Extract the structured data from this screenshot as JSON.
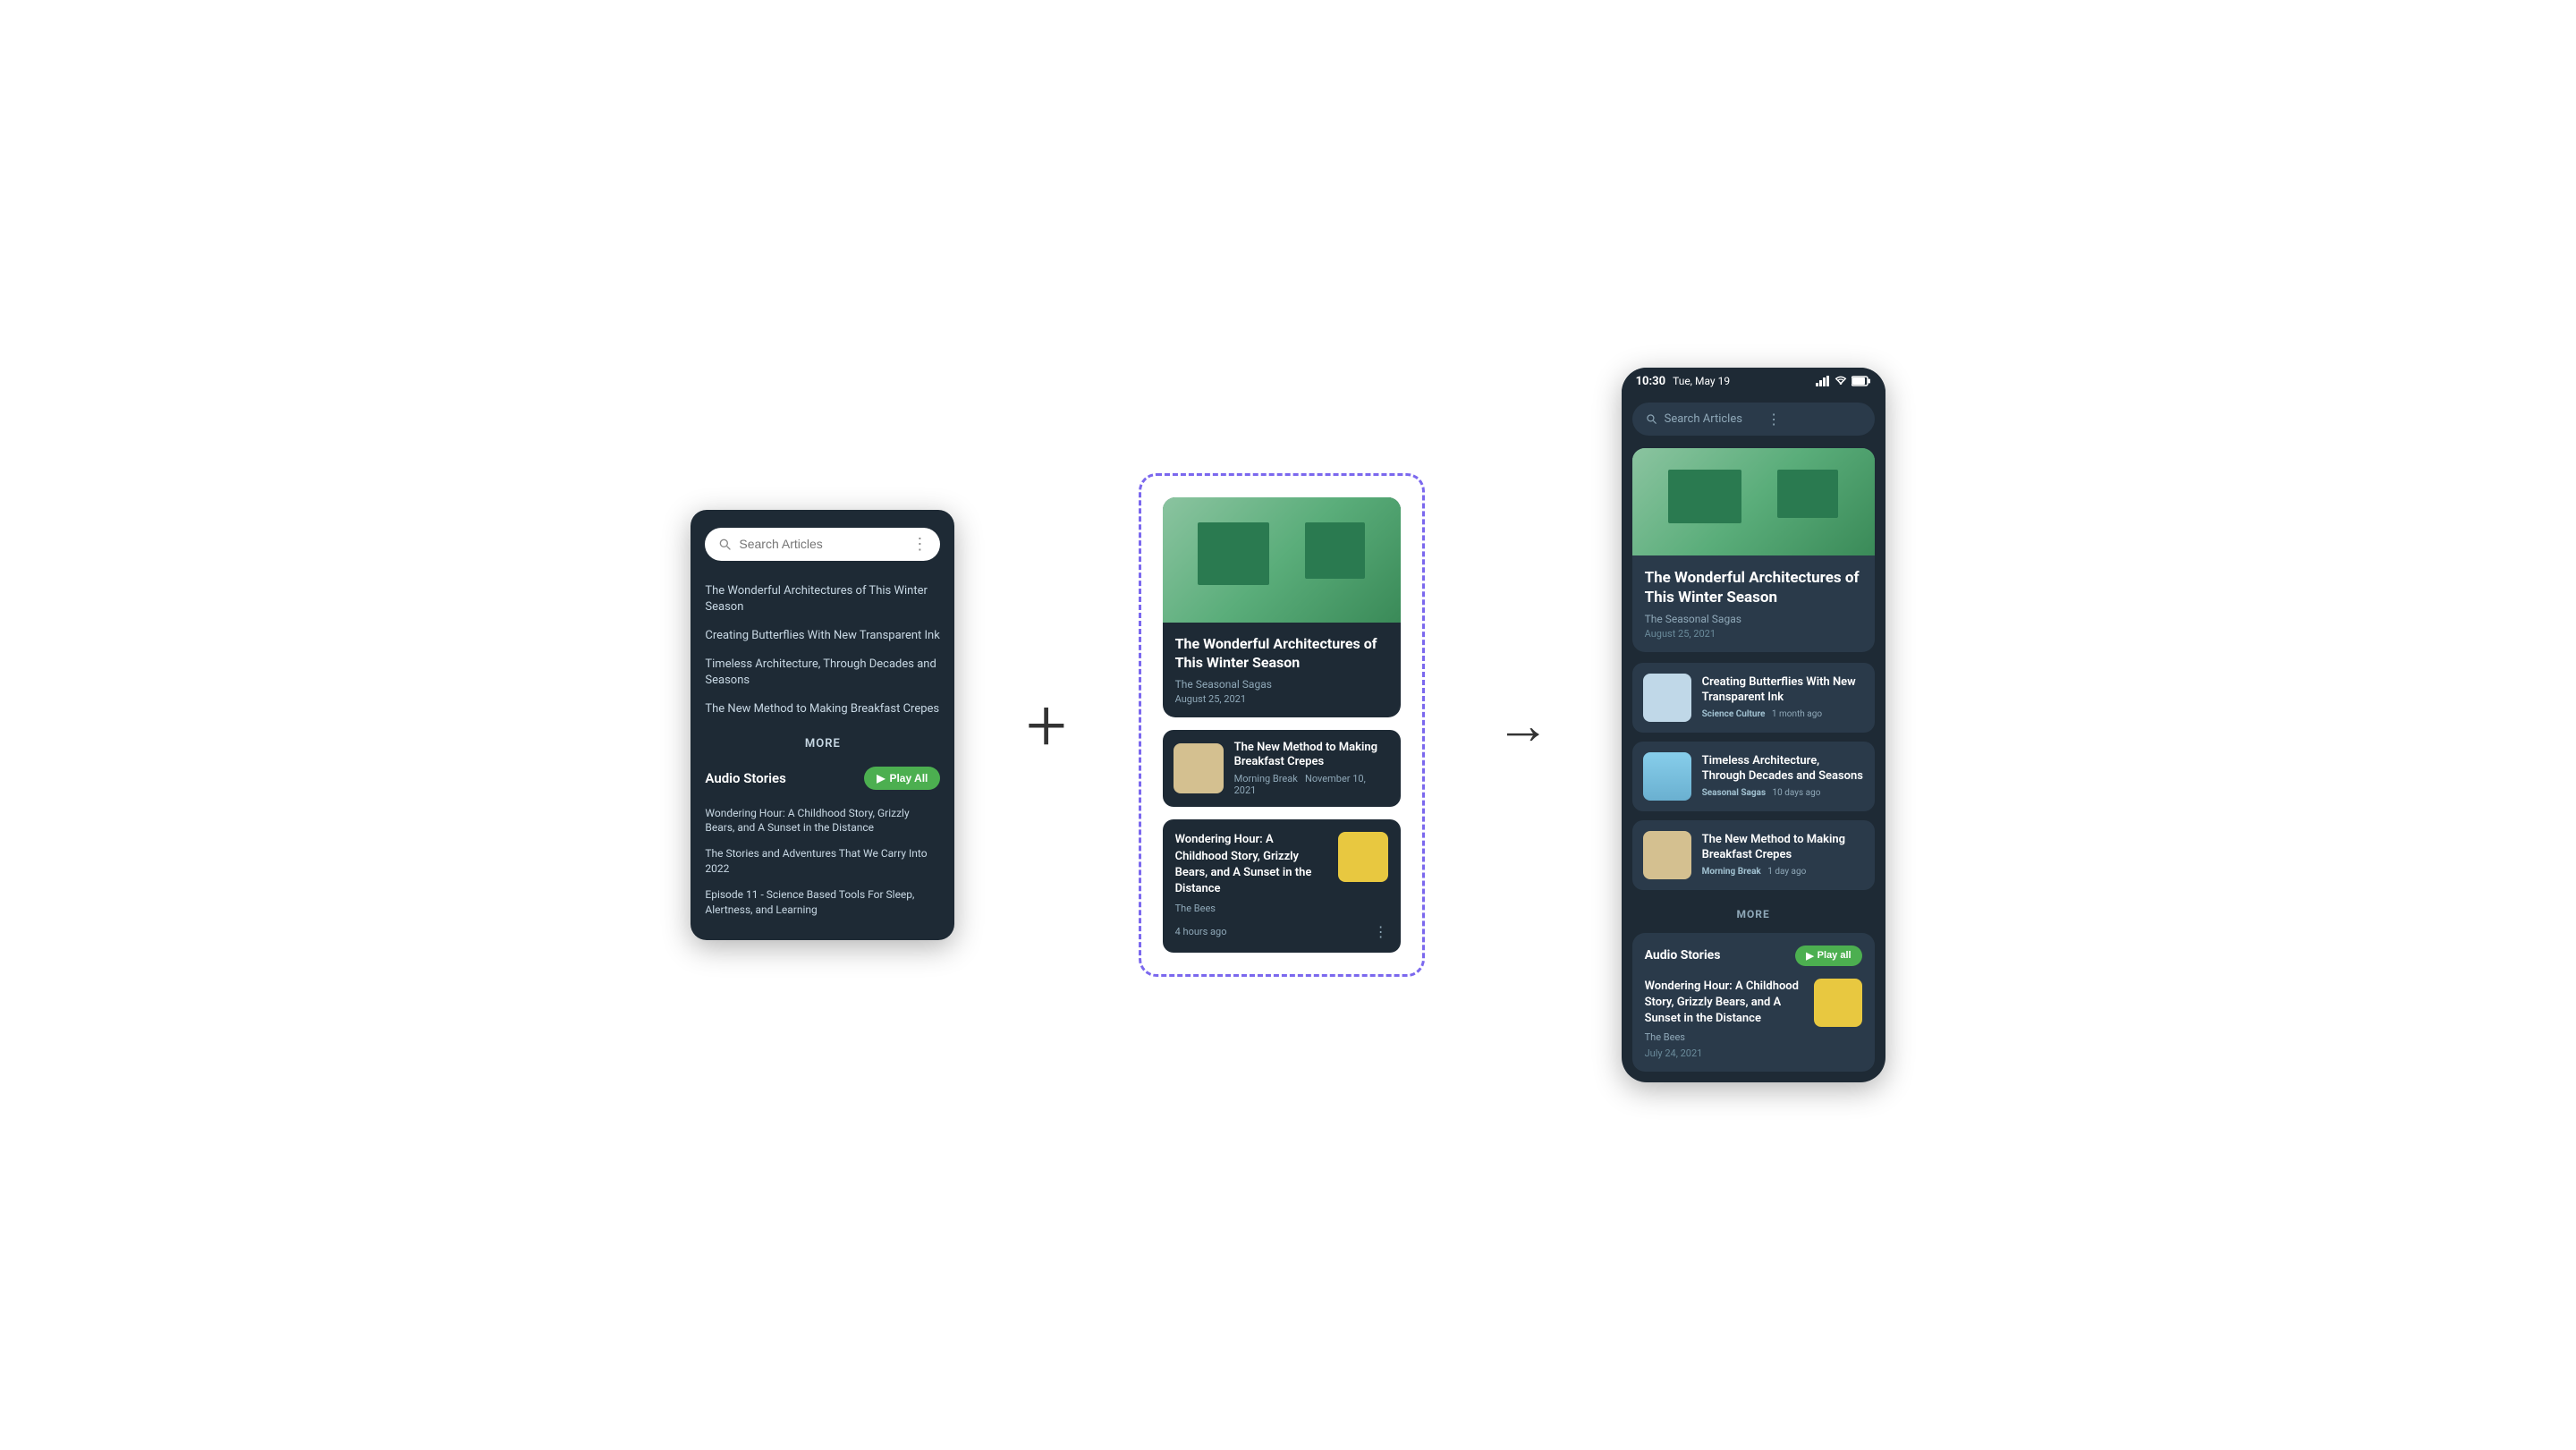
{
  "left_phone": {
    "search_placeholder": "Search Articles",
    "articles": [
      {
        "title": "The Wonderful Architectures of This Winter Season"
      },
      {
        "title": "Creating Butterflies With New Transparent Ink"
      },
      {
        "title": "Timeless Architecture, Through Decades and Seasons"
      },
      {
        "title": "The New Method to Making Breakfast Crepes"
      }
    ],
    "more_label": "MORE",
    "audio_section_title": "Audio Stories",
    "play_all_label": "Play All",
    "audio_items": [
      {
        "title": "Wondering Hour: A Childhood Story, Grizzly Bears, and A Sunset in the Distance"
      },
      {
        "title": "The Stories and Adventures That We Carry Into 2022"
      },
      {
        "title": "Episode 11 - Science Based Tools For Sleep, Alertness, and Learning"
      }
    ]
  },
  "center_component": {
    "featured_title": "The Wonderful Architectures of This Winter Season",
    "featured_source": "The Seasonal Sagas",
    "featured_date": "August 25, 2021",
    "small_card_title": "The New Method to Making Breakfast Crepes",
    "small_card_source": "Morning Break",
    "small_card_date": "November 10, 2021",
    "audio_card_title": "Wondering Hour: A Childhood Story, Grizzly Bears, and A Sunset in the Distance",
    "audio_card_source": "The Bees",
    "audio_card_time": "4 hours ago"
  },
  "right_phone": {
    "status_time": "10:30",
    "status_date": "Tue, May 19",
    "search_placeholder": "Search Articles",
    "featured": {
      "title": "The Wonderful Architectures of This Winter Season",
      "source": "The Seasonal Sagas",
      "date": "August 25, 2021"
    },
    "articles": [
      {
        "title": "Creating Butterflies With New Transparent Ink",
        "source": "Science Culture",
        "time": "1 month ago"
      },
      {
        "title": "Timeless Architecture, Through Decades and Seasons",
        "source": "Seasonal Sagas",
        "time": "10 days ago"
      },
      {
        "title": "The New Method to Making Breakfast Crepes",
        "source": "Morning Break",
        "time": "1 day ago"
      }
    ],
    "more_label": "MORE",
    "audio_section_title": "Audio Stories",
    "play_all_label": "Play all",
    "audio_featured": {
      "title": "Wondering Hour: A Childhood Story, Grizzly Bears, and A Sunset in the Distance",
      "source": "The Bees",
      "date": "July 24, 2021"
    }
  },
  "plus_symbol": "+",
  "arrow_symbol": "→"
}
